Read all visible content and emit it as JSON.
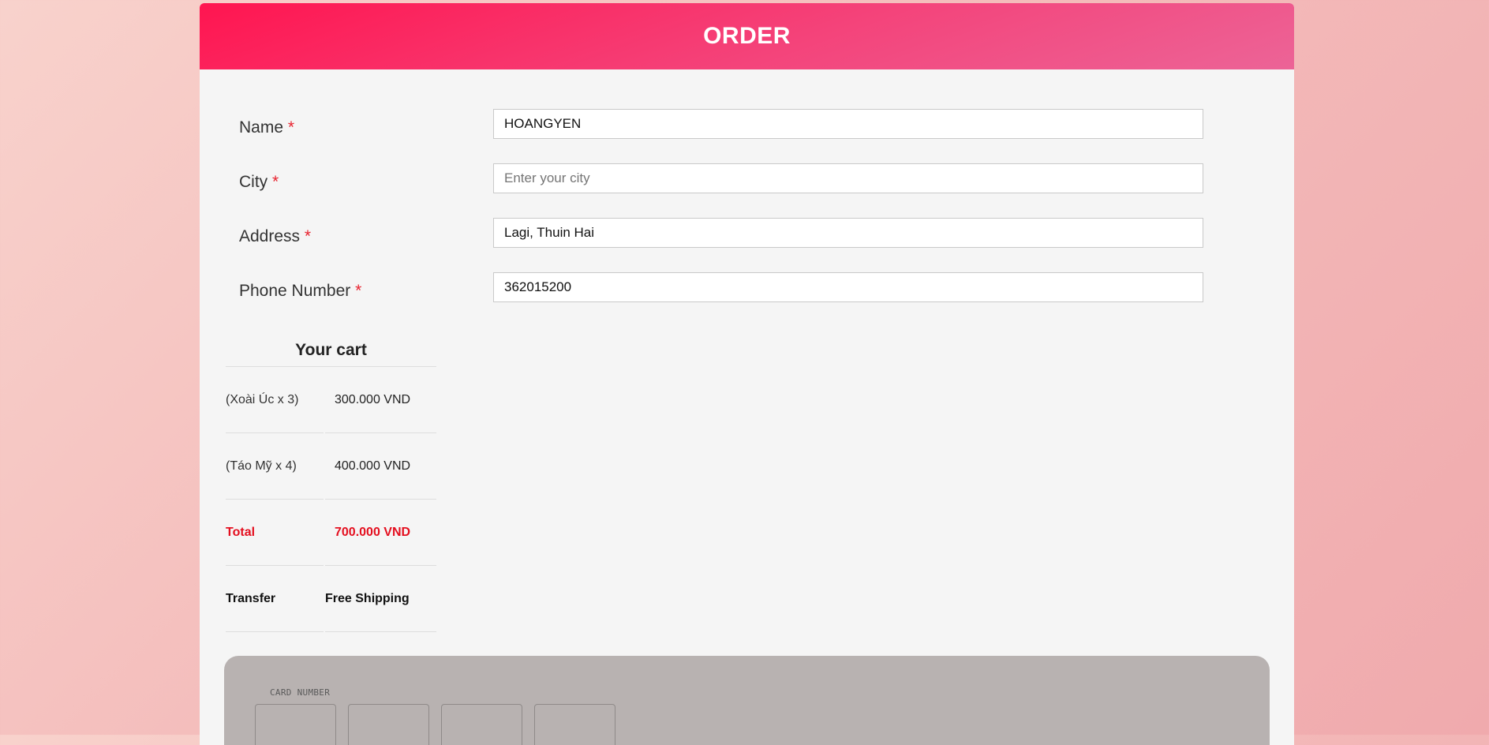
{
  "header": {
    "title": "ORDER"
  },
  "form": {
    "name": {
      "label": "Name",
      "required_mark": "*",
      "value": "HOANGYEN",
      "placeholder": ""
    },
    "city": {
      "label": "City",
      "required_mark": "*",
      "value": "",
      "placeholder": "Enter your city"
    },
    "address": {
      "label": "Address",
      "required_mark": "*",
      "value": "Lagi, Thuin Hai",
      "placeholder": ""
    },
    "phone": {
      "label": "Phone Number",
      "required_mark": "*",
      "value": "362015200",
      "placeholder": ""
    }
  },
  "cart": {
    "title": "Your cart",
    "items": [
      {
        "name": "(Xoài Úc x 3)",
        "price": "300.000 VND"
      },
      {
        "name": "(Táo Mỹ x 4)",
        "price": "400.000 VND"
      }
    ],
    "total": {
      "label": "Total",
      "value": "700.000 VND"
    },
    "shipping": {
      "label": "Transfer",
      "value": "Free Shipping"
    }
  },
  "payment": {
    "card_number_label": "CARD NUMBER",
    "card_number_fields": [
      "",
      "",
      "",
      ""
    ]
  },
  "colors": {
    "header_gradient_start": "#ff1550",
    "header_gradient_end": "#ec6497",
    "required": "#e8232f",
    "total": "#e40f1f"
  }
}
